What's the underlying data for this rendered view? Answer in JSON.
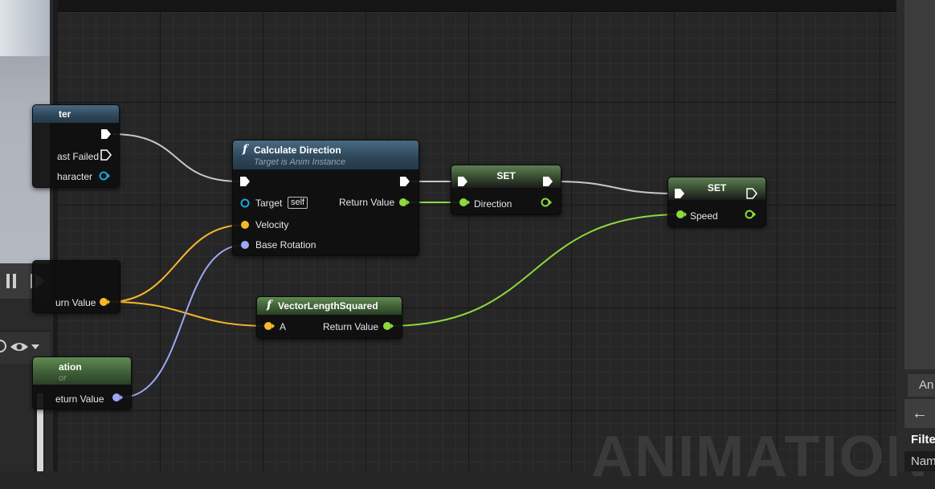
{
  "graph_title": "ANIMATION",
  "left_panel": {
    "pause_icon": "pause-icon",
    "step_icon": "step-forward-icon",
    "view_icon": "eye-icon"
  },
  "right_panel": {
    "tab_label": "An",
    "back_icon": "←",
    "filter_label": "Filte",
    "name_label": "Nam"
  },
  "nodes": {
    "character_node": {
      "title": "ter",
      "pins": [
        "ast Failed",
        "haracter"
      ]
    },
    "return_node": {
      "pin": "urn Value"
    },
    "rotation_node": {
      "title": "ation",
      "subtitle": "or",
      "pin": "eturn Value"
    },
    "calc_direction": {
      "title": "Calculate Direction",
      "subtitle": "Target is Anim Instance",
      "target_label": "Target",
      "self_label": "self",
      "velocity_label": "Velocity",
      "base_rotation_label": "Base Rotation",
      "return_label": "Return Value"
    },
    "vector_length": {
      "title": "VectorLengthSquared",
      "input_label": "A",
      "return_label": "Return Value"
    },
    "set_direction": {
      "title": "SET",
      "pin_label": "Direction"
    },
    "set_speed": {
      "title": "SET",
      "pin_label": "Speed"
    }
  },
  "colors": {
    "exec_wire": "#c8c8c8",
    "vector_pin": "#f5b82a",
    "rotator_pin": "#9aa8f5",
    "float_pin": "#8ed93e",
    "object_pin": "#1aa6e0"
  }
}
